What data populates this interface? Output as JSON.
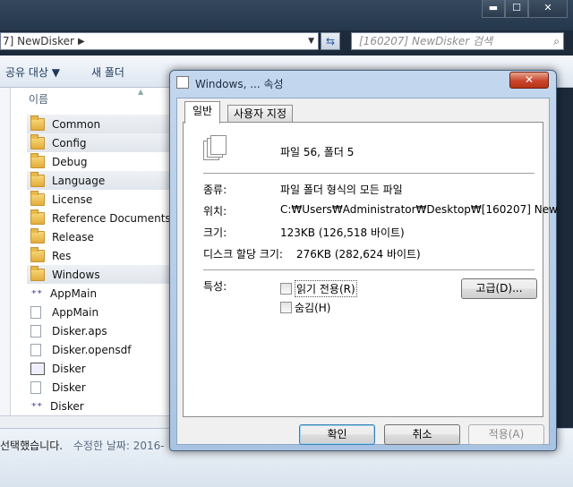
{
  "explorer": {
    "minimize_label": "▬",
    "maximize_label": "☐",
    "close_label": "✕",
    "address_text": "7] NewDisker",
    "address_arrow": "▶",
    "address_dropdown": "▼",
    "refresh_label": "⇆",
    "search_placeholder": "[160207] NewDisker 검색",
    "toolbar": {
      "share_label": "공유 대상 ▼",
      "new_folder_label": "새 폴더"
    },
    "column_header": "이름",
    "files": [
      {
        "name": "Common",
        "icon": "folder",
        "selected": true
      },
      {
        "name": "Config",
        "icon": "folder",
        "selected": true
      },
      {
        "name": "Debug",
        "icon": "folder",
        "selected": false
      },
      {
        "name": "Language",
        "icon": "folder",
        "selected": true
      },
      {
        "name": "License",
        "icon": "folder",
        "selected": false
      },
      {
        "name": "Reference Documents",
        "icon": "folder",
        "selected": false
      },
      {
        "name": "Release",
        "icon": "folder",
        "selected": false
      },
      {
        "name": "Res",
        "icon": "folder",
        "selected": false
      },
      {
        "name": "Windows",
        "icon": "folder",
        "selected": true
      },
      {
        "name": "AppMain",
        "icon": "exe",
        "selected": false
      },
      {
        "name": "AppMain",
        "icon": "doc",
        "selected": false
      },
      {
        "name": "Disker.aps",
        "icon": "doc",
        "selected": false
      },
      {
        "name": "Disker.opensdf",
        "icon": "doc",
        "selected": false
      },
      {
        "name": "Disker",
        "icon": "img",
        "selected": false
      },
      {
        "name": "Disker",
        "icon": "doc",
        "selected": false
      },
      {
        "name": "Disker",
        "icon": "exe",
        "selected": false
      }
    ],
    "status_text": "선택했습니다.",
    "status_modified": "수정한 날짜: 2016-"
  },
  "dialog": {
    "title": "Windows, ... 속성",
    "close_label": "✕",
    "tabs": [
      "일반",
      "사용자 지정"
    ],
    "summary": "파일 56, 폴더 5",
    "type_label": "종류:",
    "type_value": "파일 폴더 형식의 모든 파일",
    "location_label": "위치:",
    "location_value": "C:₩Users₩Administrator₩Desktop₩[160207] New",
    "size_label": "크기:",
    "size_value": "123KB (126,518 바이트)",
    "disk_size_label": "디스크 할당 크기:",
    "disk_size_value": "276KB (282,624 바이트)",
    "attributes_label": "특성:",
    "readonly_label": "읽기 전용(R)",
    "hidden_label": "숨김(H)",
    "advanced_label": "고급(D)...",
    "ok_label": "확인",
    "cancel_label": "취소",
    "apply_label": "적용(A)"
  }
}
